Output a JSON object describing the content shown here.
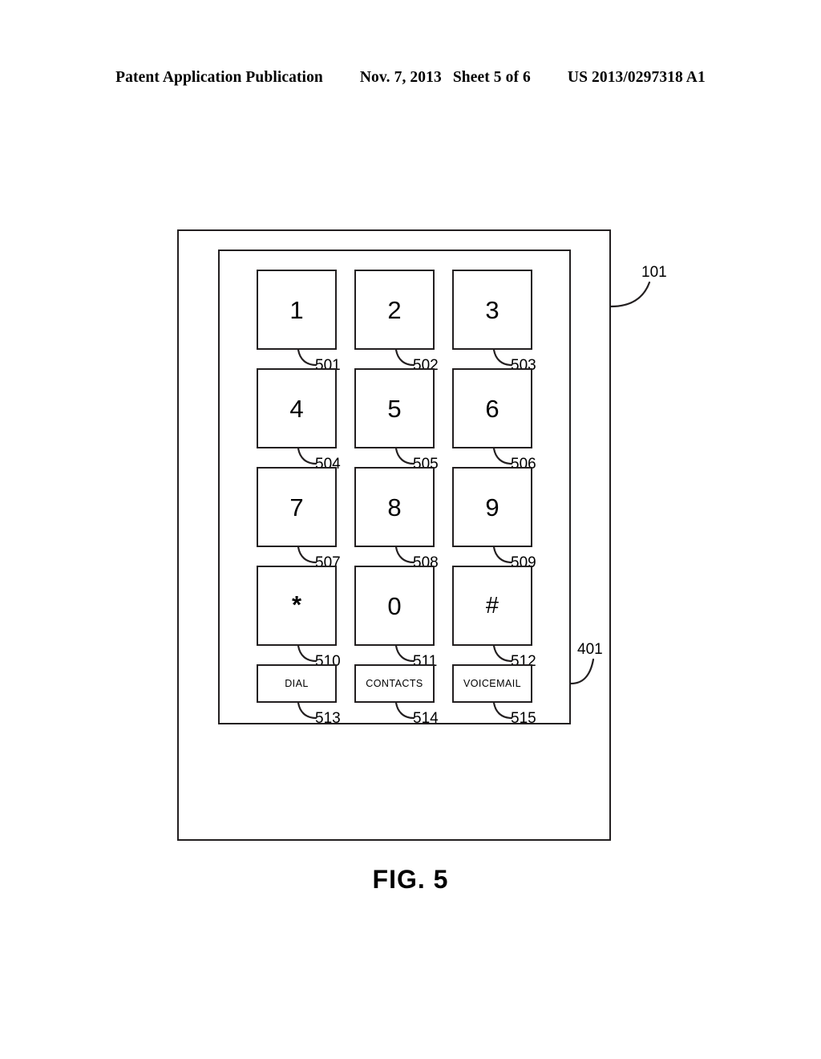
{
  "header": {
    "publication": "Patent Application Publication",
    "date": "Nov. 7, 2013",
    "sheet": "Sheet 5 of 6",
    "patent_number": "US 2013/0297318 A1"
  },
  "figure": {
    "caption": "FIG. 5",
    "device_ref": "101",
    "keypad_panel_ref": "401"
  },
  "keys": [
    {
      "label": "1",
      "ref": "501",
      "type": "digit"
    },
    {
      "label": "2",
      "ref": "502",
      "type": "digit"
    },
    {
      "label": "3",
      "ref": "503",
      "type": "digit"
    },
    {
      "label": "4",
      "ref": "504",
      "type": "digit"
    },
    {
      "label": "5",
      "ref": "505",
      "type": "digit"
    },
    {
      "label": "6",
      "ref": "506",
      "type": "digit"
    },
    {
      "label": "7",
      "ref": "507",
      "type": "digit"
    },
    {
      "label": "8",
      "ref": "508",
      "type": "digit"
    },
    {
      "label": "9",
      "ref": "509",
      "type": "digit"
    },
    {
      "label": "*",
      "ref": "510",
      "type": "star"
    },
    {
      "label": "0",
      "ref": "511",
      "type": "digit"
    },
    {
      "label": "#",
      "ref": "512",
      "type": "hash"
    },
    {
      "label": "DIAL",
      "ref": "513",
      "type": "func"
    },
    {
      "label": "CONTACTS",
      "ref": "514",
      "type": "func"
    },
    {
      "label": "VOICEMAIL",
      "ref": "515",
      "type": "func"
    }
  ],
  "colors": {
    "ink": "#231f20",
    "paper": "#ffffff"
  }
}
